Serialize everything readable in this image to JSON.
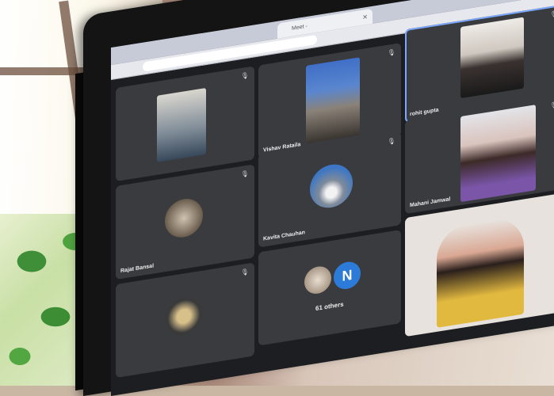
{
  "browser": {
    "tab_title": "Meet - ",
    "url": ""
  },
  "participants": [
    {
      "name": "",
      "tile": "t1"
    },
    {
      "name": "Vishav Rataila",
      "tile": "t2"
    },
    {
      "name": "rohit gupta",
      "tile": "t3",
      "speaking": true
    },
    {
      "name": "Rajat Bansal",
      "tile": "t4"
    },
    {
      "name": "Kavita Chauhan",
      "tile": "t5"
    },
    {
      "name": "Mahani Jamwal",
      "tile": "t6"
    },
    {
      "name": "",
      "tile": "t7"
    },
    {
      "name": "",
      "tile": "t8"
    }
  ],
  "others": {
    "badge": "N",
    "label": "61 others"
  },
  "colors": {
    "active_border": "#7aa7ff",
    "tile_bg": "#3a3b3f",
    "badge": "#2d7bd8"
  }
}
